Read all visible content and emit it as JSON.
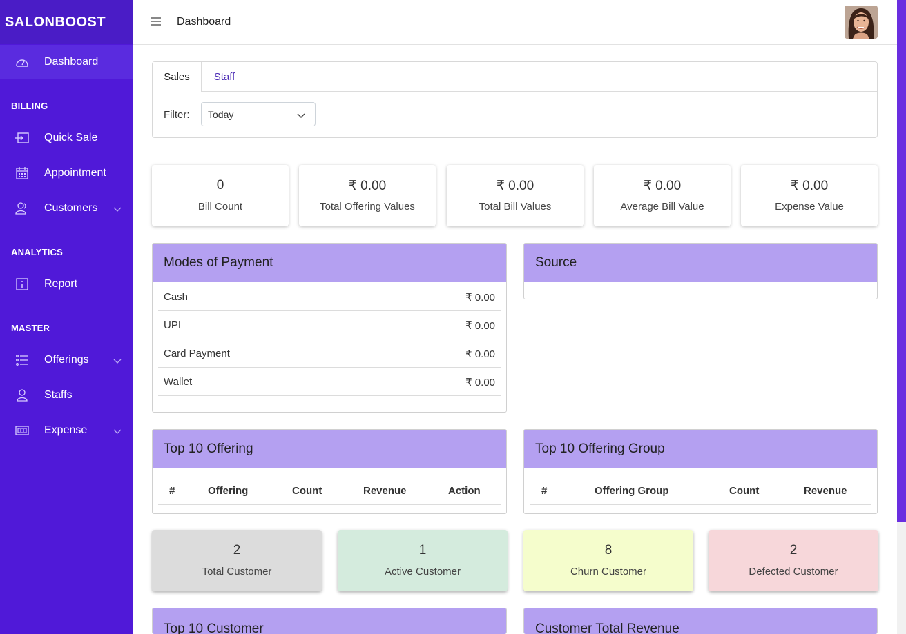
{
  "brand": "SALONBOOST",
  "topbar": {
    "title": "Dashboard"
  },
  "sidebar": {
    "dashboard": "Dashboard",
    "sections": {
      "billing": "BILLING",
      "analytics": "ANALYTICS",
      "master": "MASTER"
    },
    "items": {
      "quick_sale": "Quick Sale",
      "appointment": "Appointment",
      "customers": "Customers",
      "report": "Report",
      "offerings": "Offerings",
      "staffs": "Staffs",
      "expense": "Expense"
    }
  },
  "tabs": {
    "sales": "Sales",
    "staff": "Staff"
  },
  "filter": {
    "label": "Filter:",
    "value": "Today"
  },
  "stats": [
    {
      "value": "0",
      "label": "Bill Count"
    },
    {
      "value": "₹ 0.00",
      "label": "Total Offering Values"
    },
    {
      "value": "₹ 0.00",
      "label": "Total Bill Values"
    },
    {
      "value": "₹ 0.00",
      "label": "Average Bill Value"
    },
    {
      "value": "₹ 0.00",
      "label": "Expense Value"
    }
  ],
  "payment": {
    "title": "Modes of Payment",
    "rows": [
      {
        "name": "Cash",
        "amount": "₹ 0.00"
      },
      {
        "name": "UPI",
        "amount": "₹ 0.00"
      },
      {
        "name": "Card Payment",
        "amount": "₹ 0.00"
      },
      {
        "name": "Wallet",
        "amount": "₹ 0.00"
      }
    ]
  },
  "source": {
    "title": "Source"
  },
  "top_offering": {
    "title": "Top 10 Offering",
    "columns": [
      "#",
      "Offering",
      "Count",
      "Revenue",
      "Action"
    ]
  },
  "top_offering_group": {
    "title": "Top 10 Offering Group",
    "columns": [
      "#",
      "Offering Group",
      "Count",
      "Revenue"
    ]
  },
  "customers": [
    {
      "value": "2",
      "label": "Total Customer",
      "color": "#dcdcdc"
    },
    {
      "value": "1",
      "label": "Active Customer",
      "color": "#d4ebdd"
    },
    {
      "value": "8",
      "label": "Churn Customer",
      "color": "#f5fdcc"
    },
    {
      "value": "2",
      "label": "Defected Customer",
      "color": "#f7d7da"
    }
  ],
  "bottom_panels": {
    "top_customer": "Top 10 Customer",
    "customer_total_revenue": "Customer Total Revenue"
  },
  "colors": {
    "sidebar": "#5019d8",
    "panel_header": "#b4a0f1",
    "accent": "#4b2bb5"
  }
}
